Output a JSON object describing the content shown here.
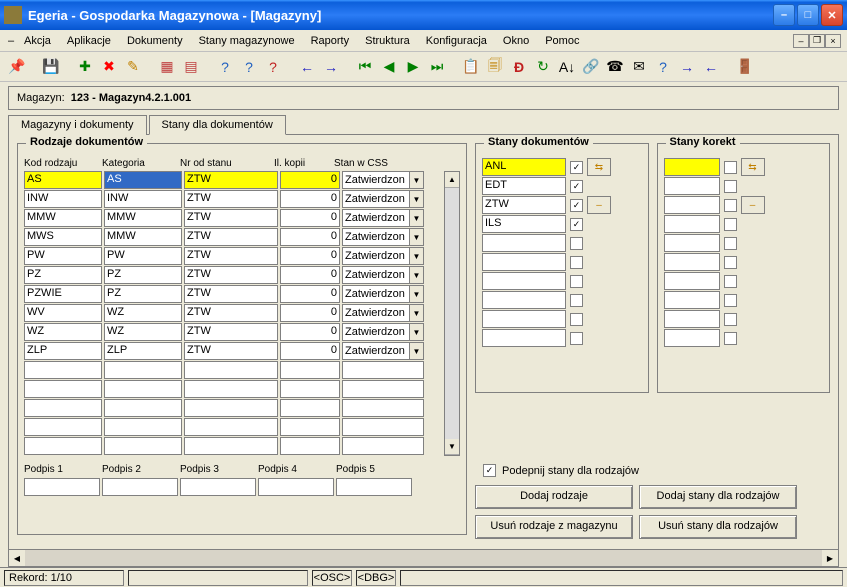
{
  "window": {
    "title": "Egeria - Gospodarka Magazynowa - [Magazyny]"
  },
  "menu": [
    "Akcja",
    "Aplikacje",
    "Dokumenty",
    "Stany magazynowe",
    "Raporty",
    "Struktura",
    "Konfiguracja",
    "Okno",
    "Pomoc"
  ],
  "magbar": {
    "label": "Magazyn:",
    "value": "123 - Magazyn4.2.1.001"
  },
  "tabs": {
    "t1": "Magazyny i dokumenty",
    "t2": "Stany dla dokumentów"
  },
  "fieldset": {
    "rodzaje": "Rodzaje dokumentów",
    "stany": "Stany dokumentów",
    "korekt": "Stany korekt"
  },
  "gridHead": {
    "kod": "Kod rodzaju",
    "kat": "Kategoria",
    "nr": "Nr od stanu",
    "il": "Il. kopii",
    "stan": "Stan w CSS"
  },
  "rows": [
    {
      "kod": "AS",
      "kat": "AS",
      "nr": "ZTW",
      "il": "0",
      "stan": "Zatwierdzony"
    },
    {
      "kod": "INW",
      "kat": "INW",
      "nr": "ZTW",
      "il": "0",
      "stan": "Zatwierdzony"
    },
    {
      "kod": "MMW",
      "kat": "MMW",
      "nr": "ZTW",
      "il": "0",
      "stan": "Zatwierdzony"
    },
    {
      "kod": "MWS",
      "kat": "MMW",
      "nr": "ZTW",
      "il": "0",
      "stan": "Zatwierdzony"
    },
    {
      "kod": "PW",
      "kat": "PW",
      "nr": "ZTW",
      "il": "0",
      "stan": "Zatwierdzony"
    },
    {
      "kod": "PZ",
      "kat": "PZ",
      "nr": "ZTW",
      "il": "0",
      "stan": "Zatwierdzony"
    },
    {
      "kod": "PZWIE",
      "kat": "PZ",
      "nr": "ZTW",
      "il": "0",
      "stan": "Zatwierdzony"
    },
    {
      "kod": "WV",
      "kat": "WZ",
      "nr": "ZTW",
      "il": "0",
      "stan": "Zatwierdzony"
    },
    {
      "kod": "WZ",
      "kat": "WZ",
      "nr": "ZTW",
      "il": "0",
      "stan": "Zatwierdzony"
    },
    {
      "kod": "ZLP",
      "kat": "ZLP",
      "nr": "ZTW",
      "il": "0",
      "stan": "Zatwierdzony"
    }
  ],
  "podpis": [
    "Podpis 1",
    "Podpis 2",
    "Podpis 3",
    "Podpis 4",
    "Podpis 5"
  ],
  "stanyRows": [
    {
      "val": "ANL",
      "chk": true
    },
    {
      "val": "EDT",
      "chk": true
    },
    {
      "val": "ZTW",
      "chk": true
    },
    {
      "val": "ILS",
      "chk": true
    },
    {
      "val": "",
      "chk": false
    },
    {
      "val": "",
      "chk": false
    },
    {
      "val": "",
      "chk": false
    },
    {
      "val": "",
      "chk": false
    },
    {
      "val": "",
      "chk": false
    },
    {
      "val": "",
      "chk": false
    }
  ],
  "korektRows": [
    true,
    false,
    false,
    false,
    false,
    false,
    false,
    false,
    false,
    false
  ],
  "chkLabel": "Podepnij stany dla rodzajów",
  "buttons": {
    "b1": "Dodaj rodzaje",
    "b2": "Dodaj stany dla rodzajów",
    "b3": "Usuń rodzaje z magazynu",
    "b4": "Usuń stany dla rodzajów"
  },
  "status": {
    "rec": "Rekord: 1/10",
    "osc": "<OSC>",
    "dbg": "<DBG>"
  }
}
